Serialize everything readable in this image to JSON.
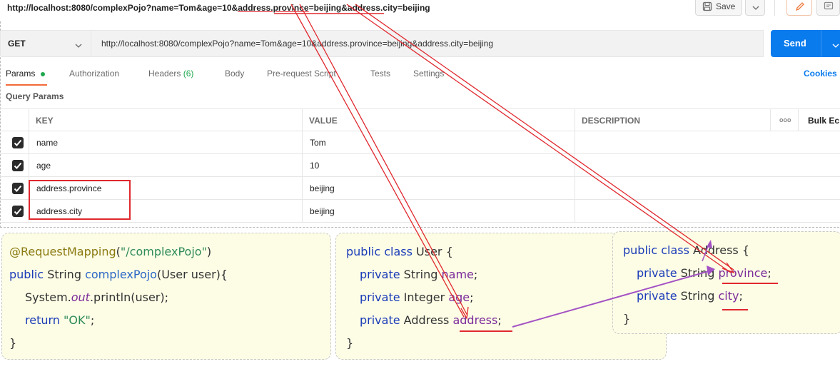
{
  "titlebar": {
    "url_prefix": "http://localhost:8080/complexPojo?name=Tom&age=10&",
    "url_province": "address.province",
    "url_mid": "=beijing&address.city=beijing",
    "save_label": "Save"
  },
  "request": {
    "method": "GET",
    "url": "http://localhost:8080/complexPojo?name=Tom&age=10&address.province=beijing&address.city=beijing",
    "send_label": "Send"
  },
  "tabs": {
    "params": "Params",
    "authorization": "Authorization",
    "headers": "Headers",
    "headers_count": "(6)",
    "body": "Body",
    "prerequest": "Pre-request Script",
    "tests": "Tests",
    "settings": "Settings",
    "cookies": "Cookies"
  },
  "query_params_label": "Query Params",
  "table": {
    "col_key": "KEY",
    "col_value": "VALUE",
    "col_description": "DESCRIPTION",
    "more": "ooo",
    "bulk_edit": "Bulk Ec",
    "rows": [
      {
        "key": "name",
        "value": "Tom"
      },
      {
        "key": "age",
        "value": "10"
      },
      {
        "key": "address.province",
        "value": "beijing"
      },
      {
        "key": "address.city",
        "value": "beijing"
      }
    ]
  },
  "code_controller": {
    "l1_ann": "@RequestMapping",
    "l1_paren_open": "(",
    "l1_str": "\"/complexPojo\"",
    "l1_paren_close": ")",
    "l2_kw": "public",
    "l2_type": " String ",
    "l2_fn": "complexPojo",
    "l2_rest": "(User user){",
    "l3_a": "System.",
    "l3_out": "out",
    "l3_b": ".println(user);",
    "l4_kw": "return",
    "l4_str": " \"OK\"",
    "l4_end": ";",
    "l5": "}"
  },
  "code_user": {
    "l1_kw": "public class",
    "l1_rest": " User {",
    "l2_kw": "private",
    "l2_type": " String ",
    "l2_fld": "name",
    "l2_end": ";",
    "l3_kw": "private",
    "l3_type": " Integer ",
    "l3_fld": "age",
    "l3_end": ";",
    "l4_kw": "private",
    "l4_type": " Address ",
    "l4_fld": "address",
    "l4_end": ";",
    "l5": "}"
  },
  "code_address": {
    "l1_kw": "public class",
    "l1_rest": " Address {",
    "l2_kw": "private",
    "l2_type": " String ",
    "l2_fld": "province",
    "l2_end": ";",
    "l3_kw": "private",
    "l3_type": " String ",
    "l3_fld": "city",
    "l3_end": ";",
    "l4": "}"
  },
  "colors": {
    "accent_blue": "#097bed",
    "annotation_red": "#e0282e",
    "annotation_purple": "#a352c4",
    "params_dot": "#1fa84f"
  }
}
